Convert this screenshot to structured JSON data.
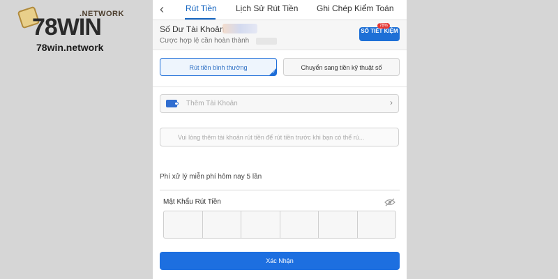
{
  "watermark": {
    "network": ".NETWORK",
    "brand": "78WIN",
    "url": "78win.network"
  },
  "nav": {
    "back_icon": "chevron-left-icon",
    "tabs": [
      {
        "label": "Rút Tiền",
        "active": true
      },
      {
        "label": "Lịch Sử Rút Tiền",
        "active": false
      },
      {
        "label": "Ghi Chép Kiểm Toán",
        "active": false
      }
    ]
  },
  "balance": {
    "label": "Số Dư Tài Khoản",
    "sub_label": "Cược hợp lệ cần hoàn thành",
    "savings_button": "SỔ TIẾT KIỆM",
    "savings_badge": "78%"
  },
  "methods": {
    "normal": "Rút tiền bình thường",
    "digital": "Chuyển sang tiền kỹ thuật số",
    "selected": "normal"
  },
  "account": {
    "add_label": "Thêm Tài Khoản",
    "icon": "wallet-icon",
    "arrow_icon": "chevron-right-icon"
  },
  "hint": {
    "text": "Vui lòng thêm tài khoản rút tiền để rút tiền trước khi bạn có thể rú..."
  },
  "fee": {
    "text": "Phí xử lý miễn phí hôm nay 5 lần"
  },
  "password": {
    "label": "Mật Khẩu Rút Tiền",
    "toggle_icon": "eye-slash-icon",
    "digits": 6
  },
  "confirm": {
    "label": "Xác Nhận"
  },
  "colors": {
    "primary": "#1d6fe0",
    "active_tab": "#1565c0",
    "badge": "#e53935"
  }
}
